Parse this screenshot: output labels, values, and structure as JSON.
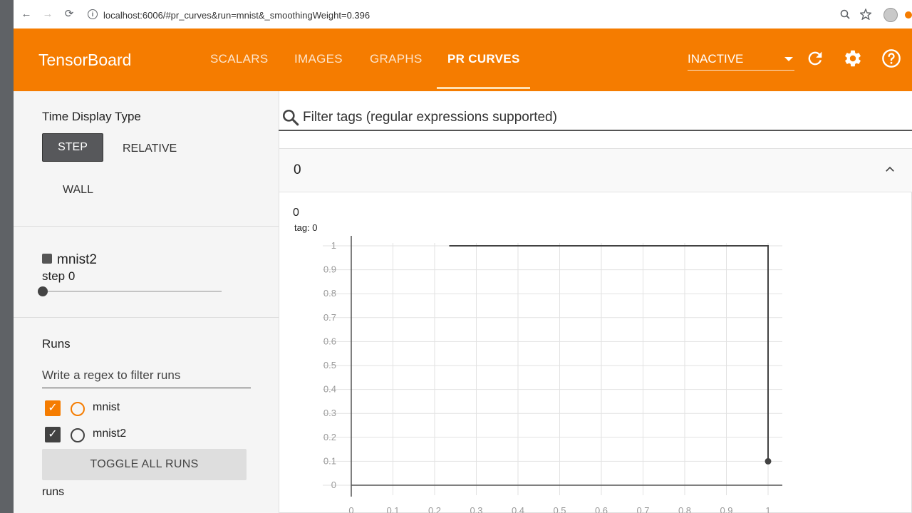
{
  "browser": {
    "url": "localhost:6006/#pr_curves&run=mnist&_smoothingWeight=0.396"
  },
  "header": {
    "brand": "TensorBoard",
    "tabs": [
      {
        "label": "SCALARS",
        "active": false
      },
      {
        "label": "IMAGES",
        "active": false
      },
      {
        "label": "GRAPHS",
        "active": false
      },
      {
        "label": "PR CURVES",
        "active": true
      }
    ],
    "inactive_label": "INACTIVE",
    "colors": {
      "bar": "#f57c00"
    }
  },
  "sidebar": {
    "time_display_title": "Time Display Type",
    "step_button": "STEP",
    "relative_button": "RELATIVE",
    "wall_button": "WALL",
    "run_name": "mnist2",
    "step_label": "step 0",
    "step_value": 0,
    "runs_title": "Runs",
    "regex_placeholder": "Write a regex to filter runs",
    "runs": [
      {
        "name": "mnist",
        "checked": true,
        "color": "#f57c00"
      },
      {
        "name": "mnist2",
        "checked": true,
        "color": "#424242"
      }
    ],
    "toggle_all_label": "TOGGLE ALL RUNS",
    "footer_text": "runs"
  },
  "main": {
    "filter_placeholder": "Filter tags (regular expressions supported)",
    "card_title": "0",
    "chart_title": "0",
    "chart_tag": "tag: 0"
  },
  "chart_data": {
    "type": "line",
    "title": "0",
    "subtitle": "tag: 0",
    "xlim": [
      0,
      1
    ],
    "ylim": [
      0,
      1
    ],
    "x_ticks": [
      "0",
      "0.1",
      "0.2",
      "0.3",
      "0.4",
      "0.5",
      "0.6",
      "0.7",
      "0.8",
      "0.9",
      "1"
    ],
    "y_ticks": [
      "0",
      "0.1",
      "0.2",
      "0.3",
      "0.4",
      "0.5",
      "0.6",
      "0.7",
      "0.8",
      "0.9",
      "1"
    ],
    "grid": true,
    "series": [
      {
        "color": "#424242",
        "x": [
          0.235,
          1,
          1
        ],
        "y": [
          1,
          1,
          0.1
        ],
        "endpoint": {
          "x": 1,
          "y": 0.1
        }
      }
    ]
  }
}
